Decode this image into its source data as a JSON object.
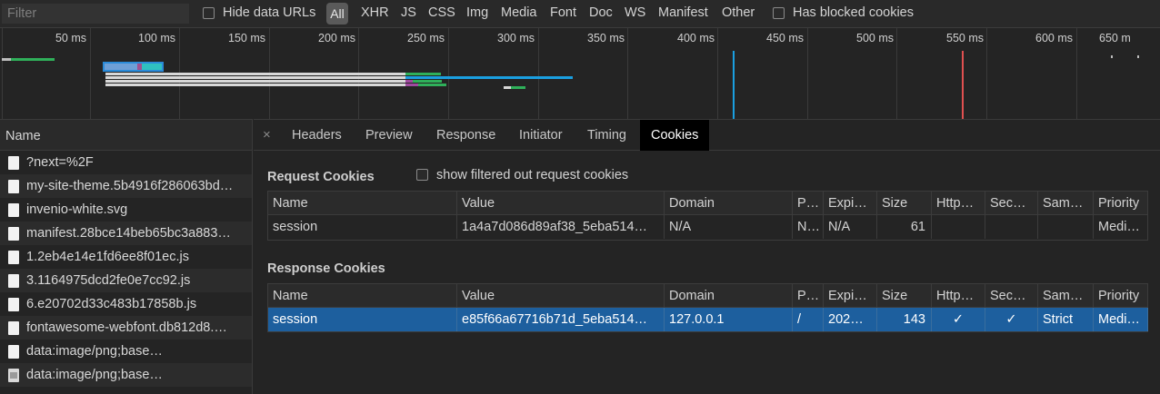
{
  "filter": {
    "placeholder": "Filter",
    "value": ""
  },
  "filterbar": {
    "hide_data_urls_label": "Hide data URLs",
    "types": [
      "All",
      "XHR",
      "JS",
      "CSS",
      "Img",
      "Media",
      "Font",
      "Doc",
      "WS",
      "Manifest",
      "Other"
    ],
    "active_type": "All",
    "has_blocked_cookies_label": "Has blocked cookies"
  },
  "overview": {
    "ticks": [
      "50 ms",
      "100 ms",
      "150 ms",
      "200 ms",
      "250 ms",
      "300 ms",
      "350 ms",
      "400 ms",
      "450 ms",
      "500 ms",
      "550 ms",
      "600 ms",
      "650 m"
    ],
    "colors": {
      "dom_content_loaded": "#1a9fe0",
      "load": "#e05050",
      "receive": "#2fb05a",
      "waiting": "#d0d0d0"
    }
  },
  "namecol": {
    "header": "Name",
    "rows": [
      {
        "name": "?next=%2F",
        "icon": "document-icon"
      },
      {
        "name": "my-site-theme.5b4916f286063bd…",
        "icon": "document-icon"
      },
      {
        "name": "invenio-white.svg",
        "icon": "document-icon"
      },
      {
        "name": "manifest.28bce14beb65bc3a883…",
        "icon": "document-icon"
      },
      {
        "name": "1.2eb4e14e1fd6ee8f01ec.js",
        "icon": "document-icon"
      },
      {
        "name": "3.1164975dcd2fe0e7cc92.js",
        "icon": "document-icon"
      },
      {
        "name": "6.e20702d33c483b17858b.js",
        "icon": "document-icon"
      },
      {
        "name": "fontawesome-webfont.db812d8.…",
        "icon": "document-icon"
      },
      {
        "name": "data:image/png;base…",
        "icon": "document-icon"
      },
      {
        "name": "data:image/png;base…",
        "icon": "image-icon"
      }
    ]
  },
  "tabs": {
    "close": "×",
    "items": [
      "Headers",
      "Preview",
      "Response",
      "Initiator",
      "Timing",
      "Cookies"
    ],
    "active": "Cookies"
  },
  "request_cookies": {
    "title": "Request Cookies",
    "show_filtered_label": "show filtered out request cookies",
    "columns": [
      "Name",
      "Value",
      "Domain",
      "P…",
      "Expi…",
      "Size",
      "Http…",
      "Sec…",
      "Sam…",
      "Priority"
    ],
    "rows": [
      [
        "session",
        "1a4a7d086d89af38_5eba514…",
        "N/A",
        "N…",
        "N/A",
        "61",
        "",
        "",
        "",
        "Medi…"
      ]
    ]
  },
  "response_cookies": {
    "title": "Response Cookies",
    "columns": [
      "Name",
      "Value",
      "Domain",
      "P…",
      "Expi…",
      "Size",
      "Http…",
      "Sec…",
      "Sam…",
      "Priority"
    ],
    "rows": [
      [
        "session",
        "e85f66a67716b71d_5eba514…",
        "127.0.0.1",
        "/",
        "202…",
        "143",
        "✓",
        "✓",
        "Strict",
        "Medi…"
      ]
    ]
  }
}
